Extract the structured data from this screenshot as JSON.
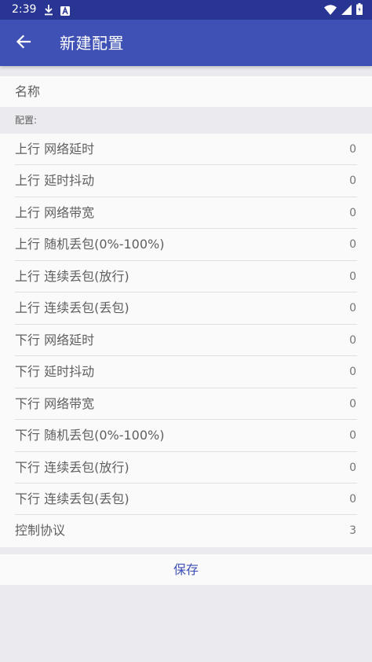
{
  "status_bar": {
    "time": "2:39",
    "left_icons": [
      "download-icon",
      "a-badge-icon"
    ],
    "right_icons": [
      "wifi-icon",
      "signal-icon",
      "battery-icon"
    ]
  },
  "app_bar": {
    "back_icon": "arrow-back-icon",
    "title": "新建配置"
  },
  "name_field": {
    "label": "名称"
  },
  "section_header": "配置:",
  "settings": [
    {
      "label": "上行 网络延时",
      "value": "0"
    },
    {
      "label": "上行 延时抖动",
      "value": "0"
    },
    {
      "label": "上行 网络带宽",
      "value": "0"
    },
    {
      "label": "上行 随机丢包(0%-100%)",
      "value": "0"
    },
    {
      "label": "上行 连续丢包(放行)",
      "value": "0"
    },
    {
      "label": "上行 连续丢包(丢包)",
      "value": "0"
    },
    {
      "label": "下行 网络延时",
      "value": "0"
    },
    {
      "label": "下行 延时抖动",
      "value": "0"
    },
    {
      "label": "下行 网络带宽",
      "value": "0"
    },
    {
      "label": "下行 随机丢包(0%-100%)",
      "value": "0"
    },
    {
      "label": "下行 连续丢包(放行)",
      "value": "0"
    },
    {
      "label": "下行 连续丢包(丢包)",
      "value": "0"
    },
    {
      "label": "控制协议",
      "value": "3"
    }
  ],
  "save_button": {
    "label": "保存"
  },
  "colors": {
    "status_bar": "#283593",
    "app_bar": "#3f51b5",
    "accent": "#3f51b5",
    "background": "#ebebef",
    "surface": "#fafafa"
  }
}
